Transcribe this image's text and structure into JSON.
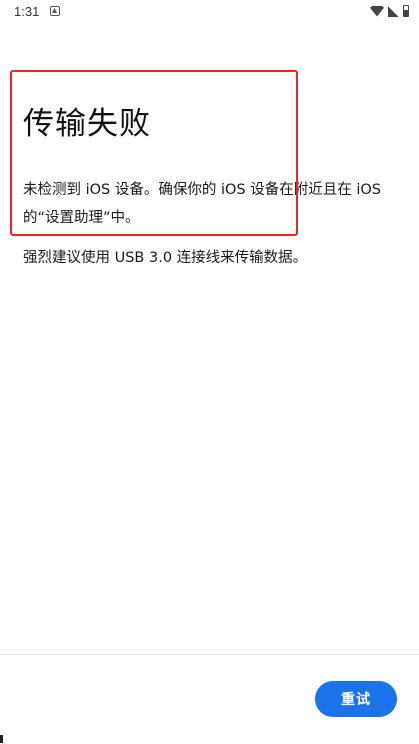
{
  "status_bar": {
    "time": "1:31",
    "notification_icon": "android-notification-icon",
    "wifi_icon": "wifi-icon",
    "signal_icon": "cellular-signal-icon",
    "battery_icon": "battery-icon"
  },
  "main": {
    "title": "传输失败",
    "description": "未检测到 iOS 设备。确保你的 iOS 设备在附近且在 iOS 的“设置助理”中。",
    "recommendation": "强烈建议使用 USB 3.0 连接线来传输数据。"
  },
  "footer": {
    "retry_label": "重试"
  },
  "colors": {
    "accent": "#1a73e8",
    "highlight": "#e8262a",
    "background": "#ffffff",
    "text": "#1a1a1a"
  }
}
